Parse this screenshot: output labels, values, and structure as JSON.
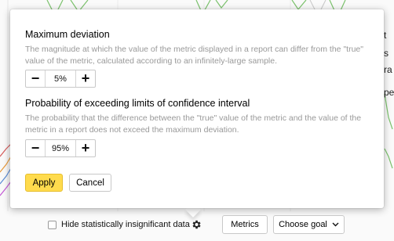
{
  "popup": {
    "max_deviation": {
      "title": "Maximum deviation",
      "description": "The magnitude at which the value of the metric displayed in a report can differ from the \"true\" value of the metric, calculated according to an infinitely-large sample.",
      "value": "5%",
      "minus": "−",
      "plus": "+"
    },
    "probability": {
      "title": "Probability of exceeding limits of confidence interval",
      "description": "The probability that the difference between the \"true\" value of the metric and the value of the metric in a report does not exceed the maximum deviation.",
      "value": "95%",
      "minus": "−",
      "plus": "+"
    },
    "apply_label": "Apply",
    "cancel_label": "Cancel",
    "accent_color": "#ffdb4d"
  },
  "background": {
    "partial_texts": [
      "t",
      "s",
      "ra",
      "pe"
    ]
  },
  "bottom_bar": {
    "hide_insignificant_label": "Hide statistically insignificant data",
    "hide_insignificant_checked": false,
    "metrics_label": "Metrics",
    "choose_goal_label": "Choose goal"
  }
}
